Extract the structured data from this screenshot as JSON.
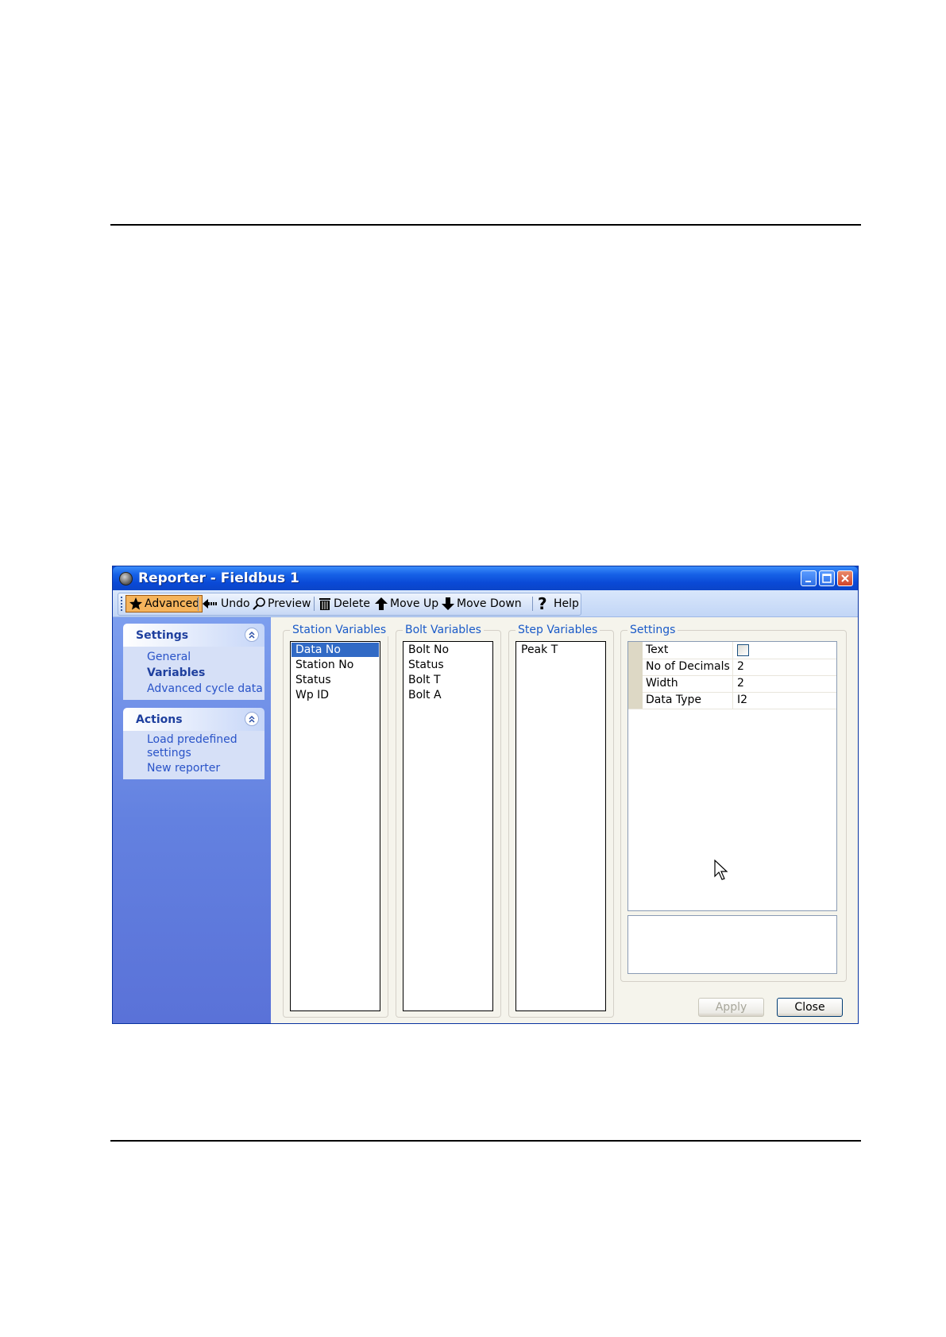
{
  "window": {
    "title": "Reporter - Fieldbus 1"
  },
  "toolbar": {
    "advanced": "Advanced",
    "undo": "Undo",
    "preview": "Preview",
    "delete": "Delete",
    "move_up": "Move Up",
    "move_down": "Move Down",
    "help": "Help"
  },
  "sidebar": {
    "settings": {
      "title": "Settings",
      "items": [
        "General",
        "Variables",
        "Advanced cycle data"
      ]
    },
    "actions": {
      "title": "Actions",
      "items": [
        "Load predefined settings",
        "New reporter"
      ]
    }
  },
  "station_variables": {
    "label": "Station Variables",
    "items": [
      "Data No",
      "Station No",
      "Status",
      "Wp ID"
    ]
  },
  "bolt_variables": {
    "label": "Bolt Variables",
    "items": [
      "Bolt No",
      "Status",
      "Bolt T",
      "Bolt A"
    ]
  },
  "step_variables": {
    "label": "Step Variables",
    "items": [
      "Peak T"
    ]
  },
  "settings_panel": {
    "label": "Settings",
    "rows": [
      {
        "name": "Text",
        "value": ""
      },
      {
        "name": "No of Decimals",
        "value": "2"
      },
      {
        "name": "Width",
        "value": "2"
      },
      {
        "name": "Data Type",
        "value": "I2"
      }
    ]
  },
  "buttons": {
    "apply": "Apply",
    "close": "Close"
  }
}
